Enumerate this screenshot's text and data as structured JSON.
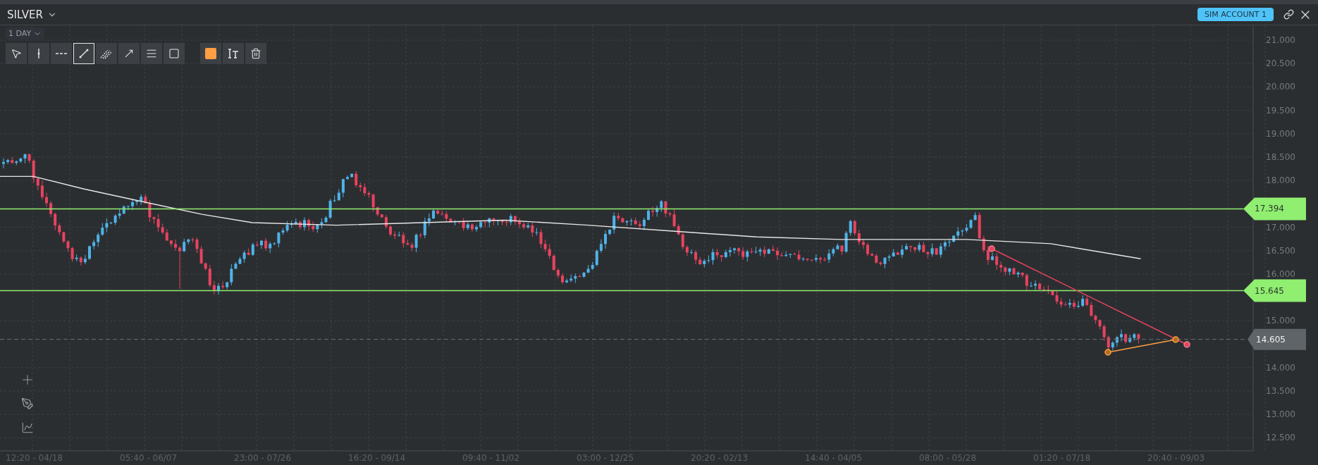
{
  "header": {
    "symbol": "SILVER",
    "account": "SIM ACCOUNT 1"
  },
  "timeframe": "1 DAY",
  "drawing_tools": [
    {
      "kind": "pointer",
      "selected": false
    },
    {
      "kind": "vertical",
      "selected": false
    },
    {
      "kind": "horizontal",
      "selected": false
    },
    {
      "kind": "trend",
      "selected": true
    },
    {
      "kind": "parallel",
      "selected": false
    },
    {
      "kind": "arrow",
      "selected": false
    },
    {
      "kind": "lines",
      "selected": false
    },
    {
      "kind": "rectangle",
      "selected": false
    }
  ],
  "style_tools": [
    {
      "kind": "color",
      "color": "#ff9f43"
    },
    {
      "kind": "text"
    },
    {
      "kind": "delete"
    }
  ],
  "price_axis": [
    "21.000",
    "20.500",
    "20.000",
    "19.500",
    "19.000",
    "18.500",
    "18.000",
    "17.000",
    "16.500",
    "16.000",
    "15.000",
    "14.000",
    "13.500",
    "13.000",
    "12.500"
  ],
  "time_axis": [
    "12:20 - 04/18",
    "05:40 - 06/07",
    "23:00 - 07/26",
    "16:20 - 09/14",
    "09:40 - 11/02",
    "03:00 - 12/25",
    "20:20 - 02/13",
    "14:40 - 04/05",
    "08:00 - 05/28",
    "01:20 - 07/18",
    "20:40 - 09/03"
  ],
  "levels": [
    {
      "label": "17.394"
    },
    {
      "label": "15.645"
    }
  ],
  "last_price": "14.605",
  "side_tools": [
    {
      "kind": "crosshair"
    },
    {
      "kind": "pen"
    },
    {
      "kind": "chart"
    }
  ]
}
